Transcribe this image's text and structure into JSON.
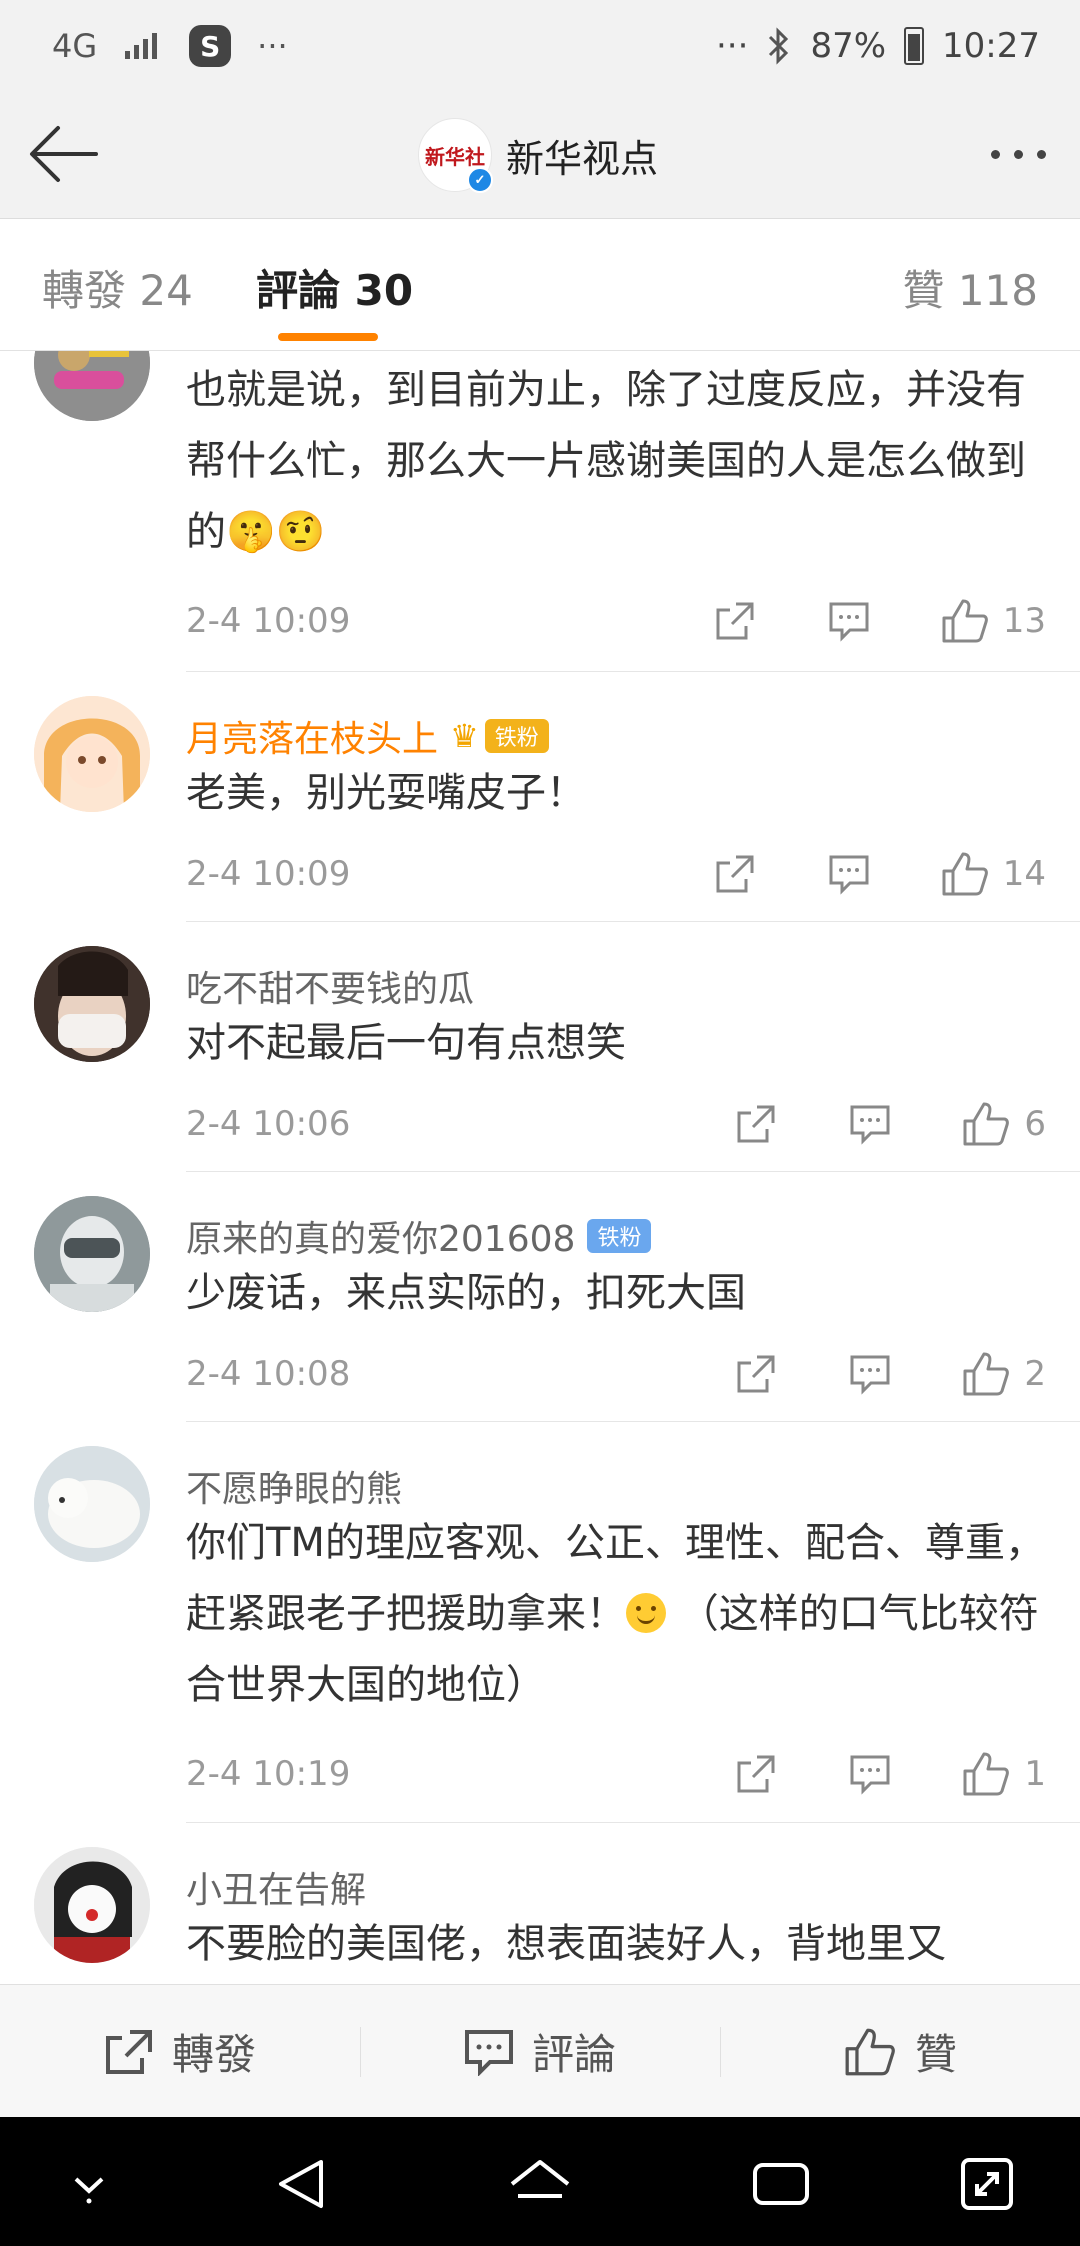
{
  "status_bar": {
    "network": "4G",
    "ellipsis_left": "···",
    "ellipsis_right": "···",
    "battery": "87%",
    "time": "10:27"
  },
  "header": {
    "account_name": "新华视点",
    "logo_text": "新华社"
  },
  "tabs": [
    {
      "label": "轉發 24"
    },
    {
      "label": "評論 30"
    },
    {
      "label": "贊 118"
    }
  ],
  "comments": [
    {
      "user": "",
      "text": "也就是说，到目前为止，除了过度反应，并没有帮什么忙，那么大一片感谢美国的人是怎么做到的🤫🤨",
      "time": "2-4 10:09",
      "likes": "13"
    },
    {
      "user": "月亮落在枝头上",
      "badge": "铁粉",
      "text": "老美，别光耍嘴皮子！",
      "time": "2-4 10:09",
      "likes": "14"
    },
    {
      "user": "吃不甜不要钱的瓜",
      "text": "对不起最后一句有点想笑",
      "time": "2-4 10:06",
      "likes": "6"
    },
    {
      "user": "原来的真的爱你201608",
      "badge": "铁粉",
      "text": "少废话，来点实际的，扣死大国",
      "time": "2-4 10:08",
      "likes": "2"
    },
    {
      "user": "不愿睁眼的熊",
      "text_a": "你们TM的理应客观、公正、理性、配合、尊重，赶紧跟老子把援助拿来！",
      "text_b": " （这样的口气比较符合世界大国的地位）",
      "time": "2-4 10:19",
      "likes": "1"
    },
    {
      "user": "小丑在告解",
      "text": "不要脸的美国佬，想表面装好人，背地里又"
    }
  ],
  "bottom_bar": {
    "repost": "轉發",
    "comment": "評論",
    "like": "贊"
  },
  "colors": {
    "accent": "#ff8200",
    "badge_blue": "#6aa7ee",
    "badge_gold": "#f3b21b"
  }
}
